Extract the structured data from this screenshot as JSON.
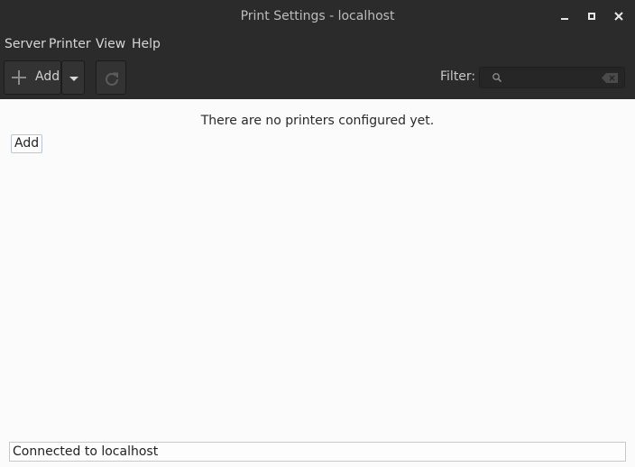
{
  "window": {
    "title": "Print Settings - localhost"
  },
  "menubar": {
    "items": [
      "Server",
      "Printer",
      "View",
      "Help"
    ]
  },
  "toolbar": {
    "add_label": "Add",
    "filter_label": "Filter:",
    "filter_value": "",
    "icons": {
      "add": "plus-icon",
      "dropdown": "chevron-down-icon",
      "refresh": "refresh-icon",
      "search": "search-icon",
      "clear": "clear-icon"
    }
  },
  "main": {
    "empty_message": "There are no printers configured yet.",
    "add_link": "Add"
  },
  "statusbar": {
    "text": "Connected to localhost"
  },
  "colors": {
    "chrome_bg": "#2b2b2b",
    "content_bg": "#fbfbfb",
    "link_border": "#bcc6d3"
  }
}
